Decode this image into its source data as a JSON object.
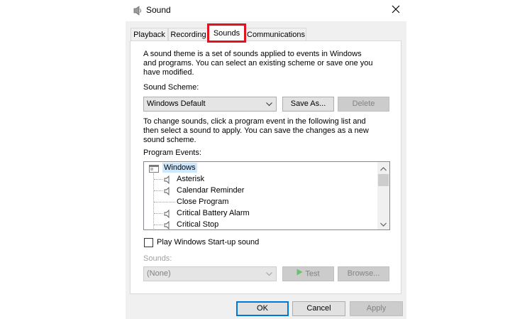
{
  "window": {
    "title": "Sound",
    "close_icon": "close-icon",
    "app_icon": "speaker-icon"
  },
  "tabs": [
    {
      "label": "Playback",
      "active": false
    },
    {
      "label": "Recording",
      "active": false
    },
    {
      "label": "Sounds",
      "active": true
    },
    {
      "label": "Communications",
      "active": false
    }
  ],
  "highlight_color": "#e0141e",
  "sounds_tab": {
    "description": "A sound theme is a set of sounds applied to events in Windows\nand programs.  You can select an existing scheme or save one you\nhave modified.",
    "scheme_label": "Sound Scheme:",
    "scheme_value": "Windows Default",
    "save_as_label": "Save As...",
    "delete_label": "Delete",
    "instructions": "To change sounds, click a program event in the following list and\nthen select a sound to apply.  You can save the changes as a new\nsound scheme.",
    "program_events_label": "Program Events:",
    "program_events": {
      "root": "Windows",
      "items": [
        {
          "label": "Asterisk",
          "has_sound": true
        },
        {
          "label": "Calendar Reminder",
          "has_sound": true
        },
        {
          "label": "Close Program",
          "has_sound": false
        },
        {
          "label": "Critical Battery Alarm",
          "has_sound": true
        },
        {
          "label": "Critical Stop",
          "has_sound": true
        }
      ]
    },
    "startup_checkbox_label": "Play Windows Start-up sound",
    "startup_checked": false,
    "sounds_label": "Sounds:",
    "sounds_value": "(None)",
    "test_label": "Test",
    "browse_label": "Browse..."
  },
  "footer": {
    "ok_label": "OK",
    "cancel_label": "Cancel",
    "apply_label": "Apply"
  }
}
